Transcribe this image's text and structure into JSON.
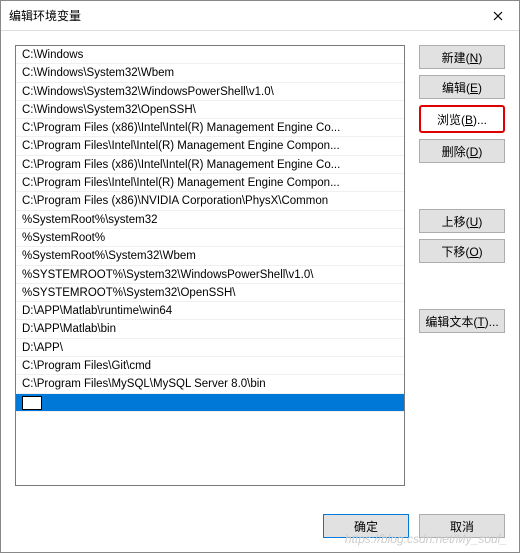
{
  "title": "编辑环境变量",
  "paths": [
    "C:\\Windows",
    "C:\\Windows\\System32\\Wbem",
    "C:\\Windows\\System32\\WindowsPowerShell\\v1.0\\",
    "C:\\Windows\\System32\\OpenSSH\\",
    "C:\\Program Files (x86)\\Intel\\Intel(R) Management Engine Co...",
    "C:\\Program Files\\Intel\\Intel(R) Management Engine Compon...",
    "C:\\Program Files (x86)\\Intel\\Intel(R) Management Engine Co...",
    "C:\\Program Files\\Intel\\Intel(R) Management Engine Compon...",
    "C:\\Program Files (x86)\\NVIDIA Corporation\\PhysX\\Common",
    "%SystemRoot%\\system32",
    "%SystemRoot%",
    "%SystemRoot%\\System32\\Wbem",
    "%SYSTEMROOT%\\System32\\WindowsPowerShell\\v1.0\\",
    "%SYSTEMROOT%\\System32\\OpenSSH\\",
    "D:\\APP\\Matlab\\runtime\\win64",
    "D:\\APP\\Matlab\\bin",
    "D:\\APP\\",
    "C:\\Program Files\\Git\\cmd",
    "C:\\Program Files\\MySQL\\MySQL Server 8.0\\bin"
  ],
  "selected_index": 19,
  "buttons": {
    "new": {
      "text": "新建",
      "key": "N"
    },
    "edit": {
      "text": "编辑",
      "key": "E"
    },
    "browse": {
      "text": "浏览",
      "key": "B"
    },
    "delete": {
      "text": "删除",
      "key": "D"
    },
    "moveup": {
      "text": "上移",
      "key": "U"
    },
    "movedown": {
      "text": "下移",
      "key": "O"
    },
    "edittext": {
      "text": "编辑文本",
      "key": "T"
    },
    "ok": "确定",
    "cancel": "取消"
  },
  "watermark": "https://blog.csdn.net/My_soul_"
}
